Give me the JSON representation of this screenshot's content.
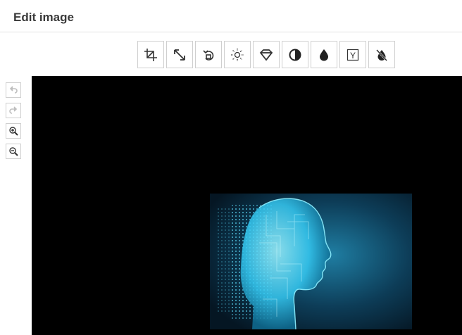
{
  "header": {
    "title": "Edit image"
  },
  "toolbar": {
    "tools": [
      {
        "name": "crop",
        "icon": "crop-icon"
      },
      {
        "name": "resize",
        "icon": "resize-arrows-icon"
      },
      {
        "name": "rotate",
        "icon": "rotate-icon"
      },
      {
        "name": "brightness",
        "icon": "sun-icon"
      },
      {
        "name": "sharpen",
        "icon": "diamond-icon"
      },
      {
        "name": "contrast",
        "icon": "half-circle-icon"
      },
      {
        "name": "color",
        "icon": "drop-icon"
      },
      {
        "name": "gamma",
        "icon": "gamma-icon"
      },
      {
        "name": "invert",
        "icon": "drop-slash-icon"
      }
    ],
    "gamma_glyph": "Y"
  },
  "side_controls": [
    {
      "name": "undo",
      "icon": "undo-icon",
      "enabled": false
    },
    {
      "name": "redo",
      "icon": "redo-icon",
      "enabled": false
    },
    {
      "name": "zoom-in",
      "icon": "zoom-in-icon",
      "enabled": true
    },
    {
      "name": "zoom-out",
      "icon": "zoom-out-icon",
      "enabled": true
    }
  ],
  "colors": {
    "canvas_bg": "#000000",
    "photo_bg": "#0a2a3e",
    "glow": "#3fd7ff"
  }
}
